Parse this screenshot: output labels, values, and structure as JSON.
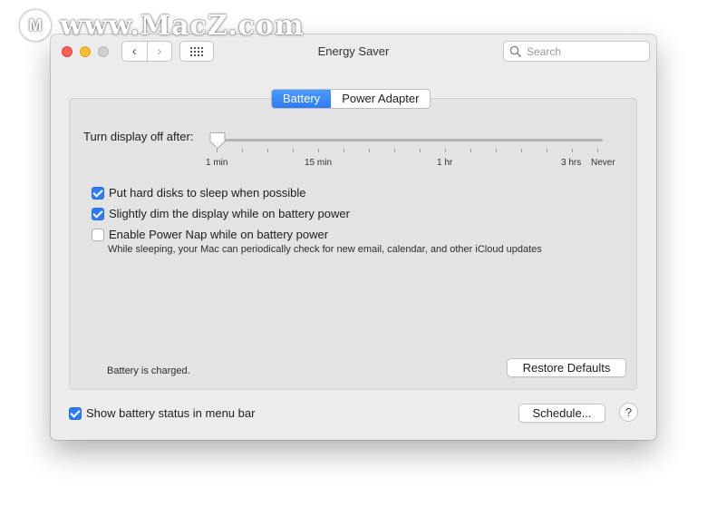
{
  "watermark": {
    "logo": "M",
    "text": "www.MacZ.com"
  },
  "window": {
    "title": "Energy Saver",
    "search_placeholder": "Search",
    "back_glyph": "‹",
    "forward_glyph": "›"
  },
  "tabs": [
    {
      "label": "Battery",
      "active": true
    },
    {
      "label": "Power Adapter",
      "active": false
    }
  ],
  "display_sleep": {
    "label": "Turn display off after:",
    "value": "1 min",
    "ticks": [
      "1 min",
      "15 min",
      "1 hr",
      "3 hrs",
      "Never"
    ]
  },
  "options": [
    {
      "label": "Put hard disks to sleep when possible",
      "checked": true
    },
    {
      "label": "Slightly dim the display while on battery power",
      "checked": true
    },
    {
      "label": "Enable Power Nap while on battery power",
      "checked": false,
      "description": "While sleeping, your Mac can periodically check for new email, calendar, and other iCloud updates"
    }
  ],
  "status_text": "Battery is charged.",
  "buttons": {
    "restore_defaults": "Restore Defaults",
    "schedule": "Schedule...",
    "help": "?"
  },
  "menu_bar_option": {
    "label": "Show battery status in menu bar",
    "checked": true
  },
  "colors": {
    "accent": "#2f7bf5",
    "close": "#fe5f57",
    "minimize": "#febc2e",
    "zoom_disabled": "#d0d0d0"
  }
}
